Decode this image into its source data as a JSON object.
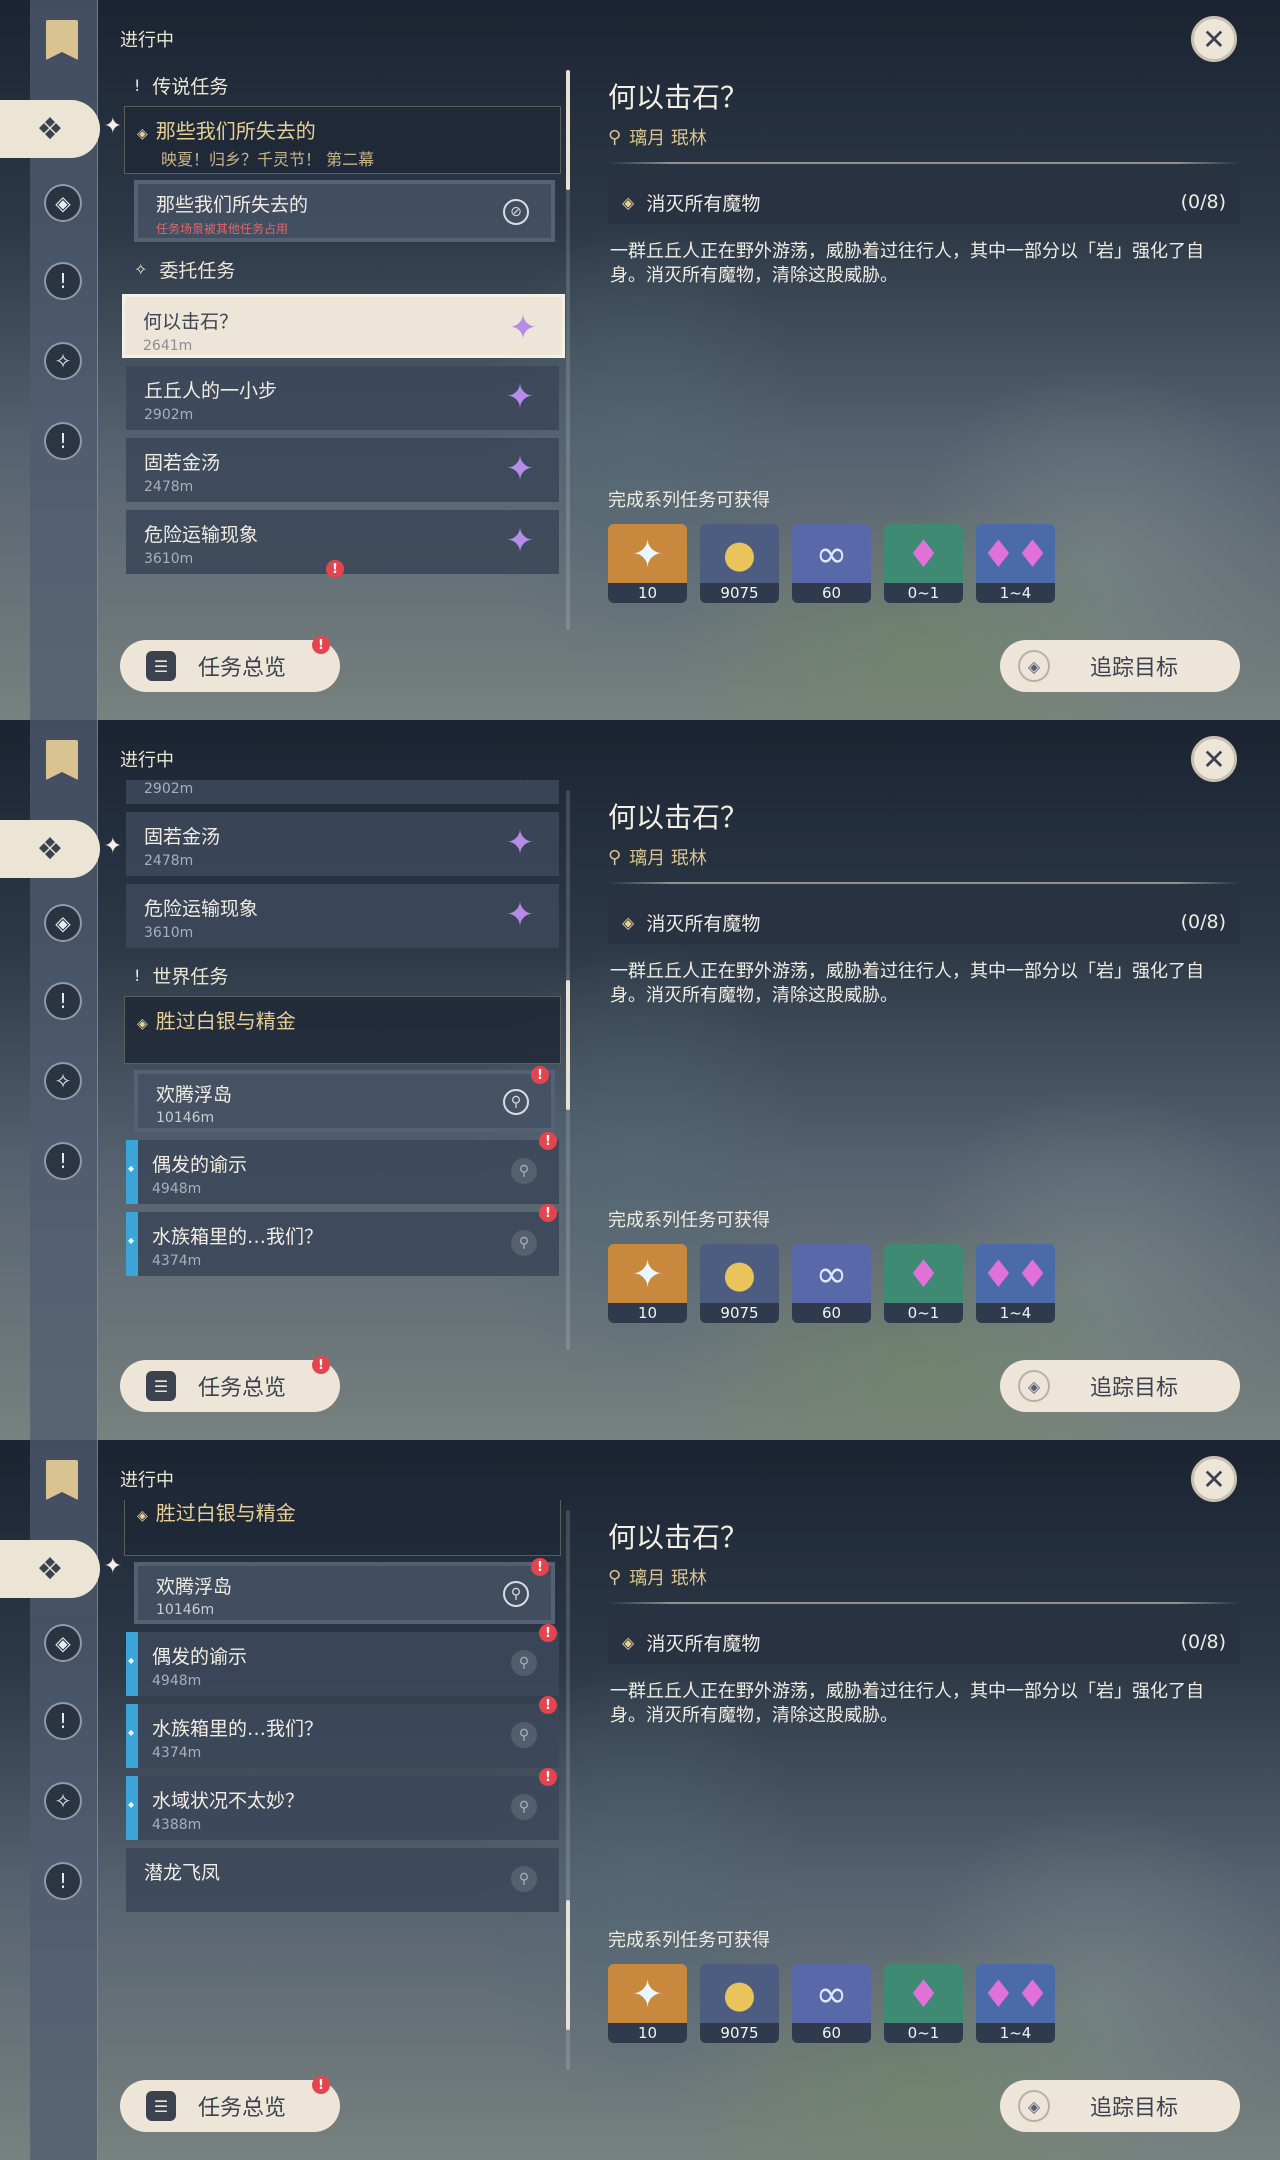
{
  "header": "进行中",
  "buttons": {
    "overview": "任务总览",
    "track": "追踪目标"
  },
  "quest_detail": {
    "title": "何以击石？",
    "location": "璃月 珉林",
    "objective": "消灭所有魔物",
    "progress": "(0/8)",
    "description": "一群丘丘人正在野外游荡，威胁着过往行人，其中一部分以「岩」强化了自身。消灭所有魔物，清除这股威胁。",
    "rewards_title": "完成系列任务可获得",
    "rewards": [
      {
        "icon": "primogem-icon",
        "count": "10"
      },
      {
        "icon": "mora-icon",
        "count": "9075"
      },
      {
        "icon": "adventure-exp-icon",
        "count": "60"
      },
      {
        "icon": "crystal-chunk-icon",
        "count": "0~1"
      },
      {
        "icon": "crystal-cluster-icon",
        "count": "1~4"
      }
    ]
  },
  "sections": {
    "legend": "传说任务",
    "commission": "委托任务",
    "world": "世界任务"
  },
  "legend_series": {
    "title": "那些我们所失去的",
    "subtitle": "映夏！归乡？千灵节！ 第二幕"
  },
  "legend_sub": {
    "title": "那些我们所失去的",
    "warning": "任务场景被其他任务占用"
  },
  "commissions": [
    {
      "title": "何以击石？",
      "distance": "2641m"
    },
    {
      "title": "丘丘人的一小步",
      "distance": "2902m"
    },
    {
      "title": "固若金汤",
      "distance": "2478m"
    },
    {
      "title": "危险运输现象",
      "distance": "3610m"
    }
  ],
  "world_series": {
    "title": "胜过白银与精金"
  },
  "world_sub": {
    "title": "欢腾浮岛",
    "distance": "10146m"
  },
  "world_quests": [
    {
      "title": "偶发的谕示",
      "distance": "4948m"
    },
    {
      "title": "水族箱里的…我们？",
      "distance": "4374m"
    },
    {
      "title": "水域状况不太妙？",
      "distance": "4388m"
    },
    {
      "title": "潜龙飞凤",
      "distance": ""
    }
  ],
  "colors": {
    "accent_cream": "#ede6d8",
    "gold": "#e6cf95",
    "badge_red": "#e4444e",
    "world_blue": "#3aa5d6",
    "commission_purple": "#b58ce6"
  }
}
